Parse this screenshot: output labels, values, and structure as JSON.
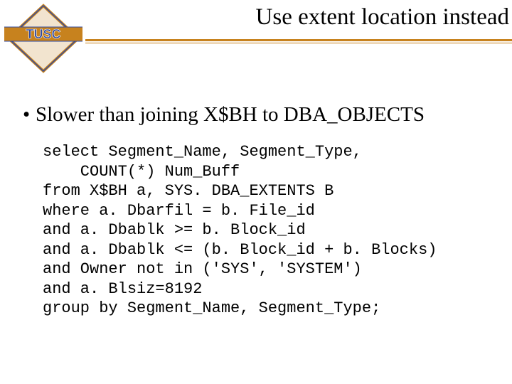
{
  "logo": {
    "text": "TUSC",
    "colors": {
      "diamond_fill": "#f2e4cf",
      "diamond_stroke1": "#c7821e",
      "diamond_stroke2": "#2f4aa0",
      "bar_fill": "#c7821e",
      "bar_stroke": "#2f4aa0",
      "text_fill": "#2f4aa0"
    }
  },
  "title": "Use extent location instead",
  "divider_color": "#c7821e",
  "bullet": {
    "marker": "•",
    "text": "Slower than joining X$BH to DBA_OBJECTS"
  },
  "code": {
    "l1": "select Segment_Name, Segment_Type,",
    "l2": "    COUNT(*) Num_Buff",
    "l3": "from X$BH a, SYS. DBA_EXTENTS B",
    "l4": "where a. Dbarfil = b. File_id",
    "l5": "and a. Dbablk >= b. Block_id",
    "l6": "and a. Dbablk <= (b. Block_id + b. Blocks)",
    "l7": "and Owner not in ('SYS', 'SYSTEM')",
    "l8": "and a. Blsiz=8192",
    "l9": "group by Segment_Name, Segment_Type;"
  }
}
